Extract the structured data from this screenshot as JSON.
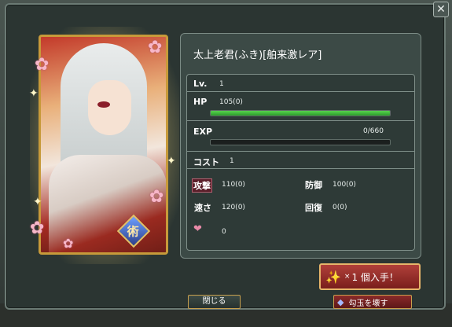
{
  "card": {
    "name": "太上老君(ふき)[舶来激レア]",
    "emblem_char": "術"
  },
  "stats": {
    "level_label": "Lv.",
    "level_value": "1",
    "hp_label": "HP",
    "hp_value": "105(0)",
    "hp_fill": 1.0,
    "exp_label": "EXP",
    "exp_value": "0/660",
    "exp_fill": 0.0,
    "cost_label": "コスト",
    "cost_value": "1",
    "attack_label": "攻撃",
    "attack_value": "110(0)",
    "defense_label": "防御",
    "defense_value": "100(0)",
    "speed_label": "速さ",
    "speed_value": "120(0)",
    "recovery_label": "回復",
    "recovery_value": "0(0)",
    "affection_value": "0"
  },
  "buttons": {
    "close_x": "✕",
    "get_prefix": "×",
    "get_label": "1 個入手！",
    "close_label": "閉じる",
    "break_label": "勾玉を壊す"
  },
  "colors": {
    "hp_bar": "#3fb83b",
    "accent_gold": "#c8a04e",
    "panel": "#3c4a46"
  }
}
